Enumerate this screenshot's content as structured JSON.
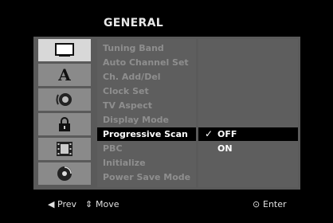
{
  "menu": {
    "title": "GENERAL"
  },
  "icons": [
    {
      "name": "display-icon",
      "active": true
    },
    {
      "name": "language-icon",
      "letter": "A"
    },
    {
      "name": "audio-icon"
    },
    {
      "name": "lock-icon"
    },
    {
      "name": "film-icon"
    },
    {
      "name": "disc-icon"
    }
  ],
  "items": [
    {
      "label": "Tuning Band"
    },
    {
      "label": "Auto Channel Set"
    },
    {
      "label": "Ch. Add/Del"
    },
    {
      "label": "Clock Set"
    },
    {
      "label": "TV Aspect"
    },
    {
      "label": "Display Mode"
    },
    {
      "label": "Progressive Scan",
      "selected": true
    },
    {
      "label": "PBC"
    },
    {
      "label": "Initialize"
    },
    {
      "label": "Power Save Mode"
    }
  ],
  "options": [
    {
      "label": "OFF",
      "checked": true,
      "check": "✓"
    },
    {
      "label": "ON",
      "checked": false
    }
  ],
  "footer": {
    "prev_label": "Prev",
    "prev_glyph": "◀",
    "move_label": "Move",
    "move_glyph": "⇕",
    "enter_label": "Enter",
    "enter_glyph": "⊙"
  }
}
